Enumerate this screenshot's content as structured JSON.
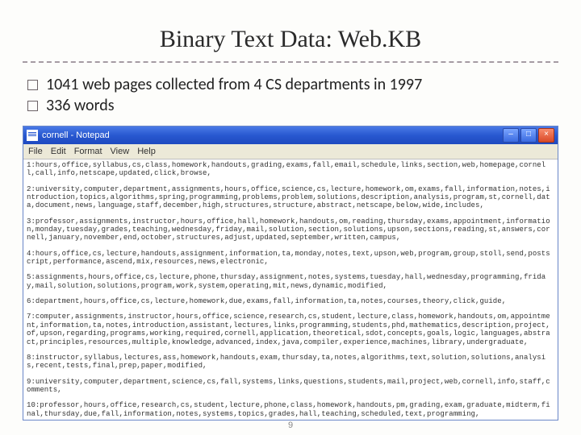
{
  "title": "Binary Text Data: Web.KB",
  "bullets": [
    "1041 web pages collected from 4 CS departments in 1997",
    " 336 words"
  ],
  "notepad": {
    "window_title": "cornell - Notepad",
    "menus": [
      "File",
      "Edit",
      "Format",
      "View",
      "Help"
    ],
    "win_min_glyph": "–",
    "win_max_glyph": "□",
    "win_close_glyph": "×",
    "lines": [
      "1:hours,office,syllabus,cs,class,homework,handouts,grading,exams,fall,email,schedule,links,section,web,homepage,cornell,call,info,netscape,updated,click,browse,",
      "2:university,computer,department,assignments,hours,office,science,cs,lecture,homework,om,exams,fall,information,notes,introduction,topics,algorithms,spring,programming,problems,problem,solutions,description,analysis,program,st,cornell,data,document,news,language,staff,december,high,structures,structure,abstract,netscape,below,wide,includes,",
      "3:professor,assignments,instructor,hours,office,hall,homework,handouts,om,reading,thursday,exams,appointment,information,monday,tuesday,grades,teaching,wednesday,friday,mail,solution,section,solutions,upson,sections,reading,st,answers,cornell,january,november,end,october,structures,adjust,updated,september,written,campus,",
      "4:hours,office,cs,lecture,handouts,assignment,information,ta,monday,notes,text,upson,web,program,group,stoll,send,postscript,performance,ascend,mix,resources,news,electronic,",
      "5:assignments,hours,office,cs,lecture,phone,thursday,assignment,notes,systems,tuesday,hall,wednesday,programming,friday,mail,solution,solutions,program,work,system,operating,mit,news,dynamic,modified,",
      "6:department,hours,office,cs,lecture,homework,due,exams,fall,information,ta,notes,courses,theory,click,guide,",
      "7:computer,assignments,instructor,hours,office,science,research,cs,student,lecture,class,homework,handouts,om,appointment,information,ta,notes,introduction,assistant,lectures,links,programming,students,phd,mathematics,description,project,of,upson,regarding,programs,working,required,cornell,application,theoretical,sdot,concepts,goals,logic,languages,abstract,principles,resources,multiple,knowledge,advanced,index,java,compiler,experience,machines,library,undergraduate,",
      "8:instructor,syllabus,lectures,ass,homework,handouts,exam,thursday,ta,notes,algorithms,text,solution,solutions,analysis,recent,tests,final,prep,paper,modified,",
      "9:university,computer,department,science,cs,fall,systems,links,questions,students,mail,project,web,cornell,info,staff,comments,",
      "10:professor,hours,office,research,cs,student,lecture,phone,class,homework,handouts,pm,grading,exam,graduate,midterm,final,thursday,due,fall,information,notes,systems,topics,grades,hall,teaching,scheduled,text,programming,"
    ]
  },
  "page_number": "9"
}
